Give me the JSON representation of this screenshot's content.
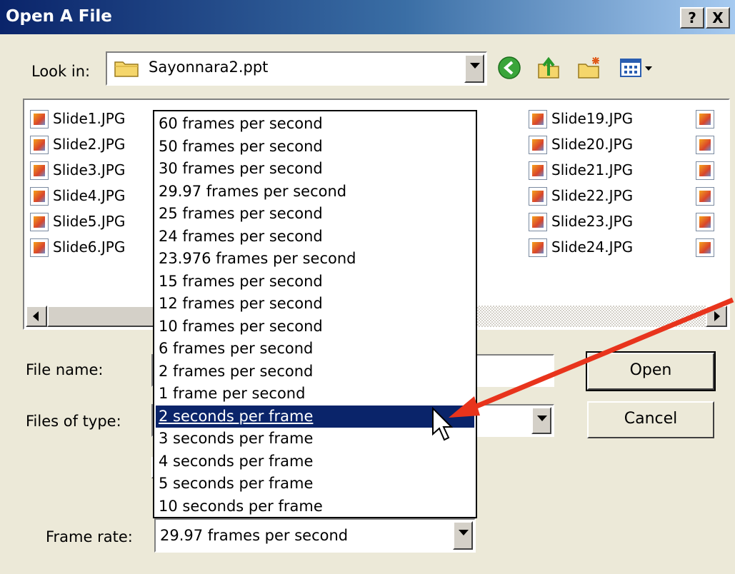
{
  "window": {
    "title": "Open A File",
    "help_label": "?",
    "close_label": "X"
  },
  "lookin": {
    "label": "Look in:",
    "value": "Sayonnara2.ppt"
  },
  "toolbar_icons": [
    "back-icon",
    "up-folder-icon",
    "new-folder-icon",
    "view-menu-icon"
  ],
  "files": [
    "Slide1.JPG",
    "Slide2.JPG",
    "Slide3.JPG",
    "Slide4.JPG",
    "Slide5.JPG",
    "Slide6.JPG",
    "Slide19.JPG",
    "Slide20.JPG",
    "Slide21.JPG",
    "Slide22.JPG",
    "Slide23.JPG",
    "Slide24.JPG"
  ],
  "filename": {
    "label": "File name:"
  },
  "filetype": {
    "label": "Files of type:"
  },
  "buttons": {
    "open": "Open",
    "cancel": "Cancel"
  },
  "framerate": {
    "label": "Frame rate:",
    "value": "29.97 frames per second",
    "selected_index": 13,
    "options": [
      "60 frames per second",
      "50 frames per second",
      "30 frames per second",
      "29.97 frames per second",
      "25 frames per second",
      "24 frames per second",
      "23.976 frames per second",
      "15 frames per second",
      "12 frames per second",
      "10 frames per second",
      "6 frames per second",
      "2 frames per second",
      "1 frame per second",
      "2 seconds per frame",
      "3 seconds per frame",
      "4 seconds per frame",
      "5 seconds per frame",
      "10 seconds per frame"
    ]
  },
  "colors": {
    "title_bar": "#0a246a",
    "selection": "#0a246a",
    "annotation_arrow": "#e8341c"
  }
}
